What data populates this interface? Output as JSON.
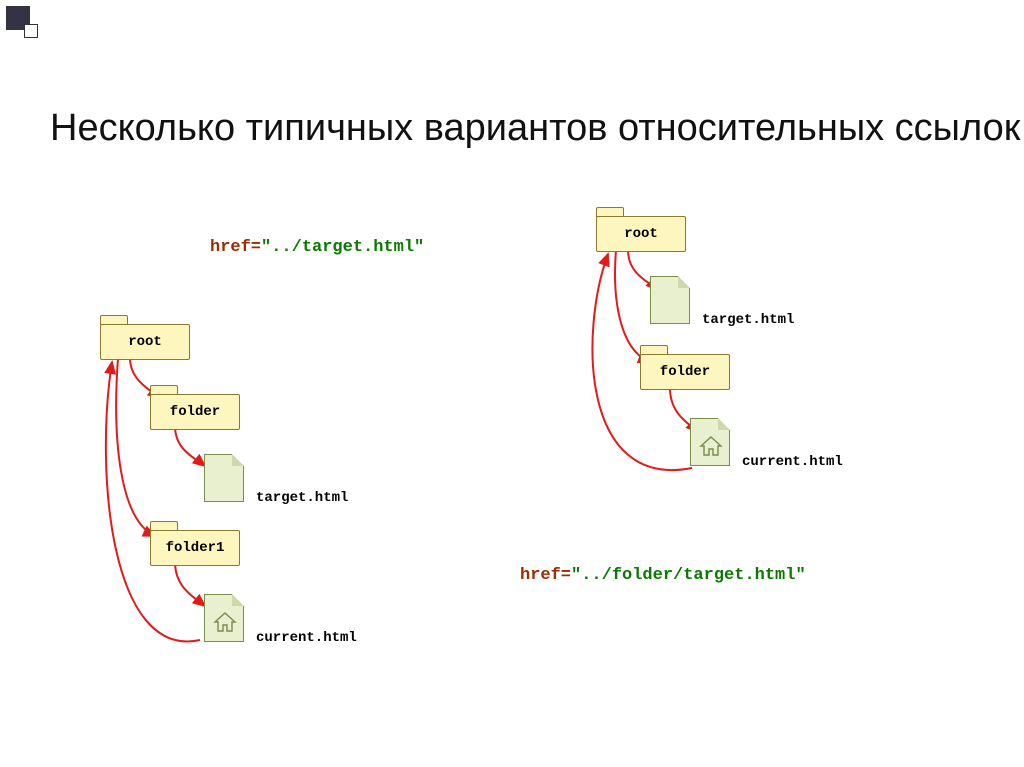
{
  "title": "Несколько типичных вариантов относительных ссылок",
  "code1": {
    "prefix": "href=",
    "value": "\"../target.html\""
  },
  "code2": {
    "prefix": "href=",
    "value": "\"../folder/target.html\""
  },
  "left": {
    "root": "root",
    "folder_a": "folder",
    "target": "target.html",
    "folder_b": "folder1",
    "current": "current.html"
  },
  "right": {
    "root": "root",
    "target": "target.html",
    "folder": "folder",
    "current": "current.html"
  }
}
